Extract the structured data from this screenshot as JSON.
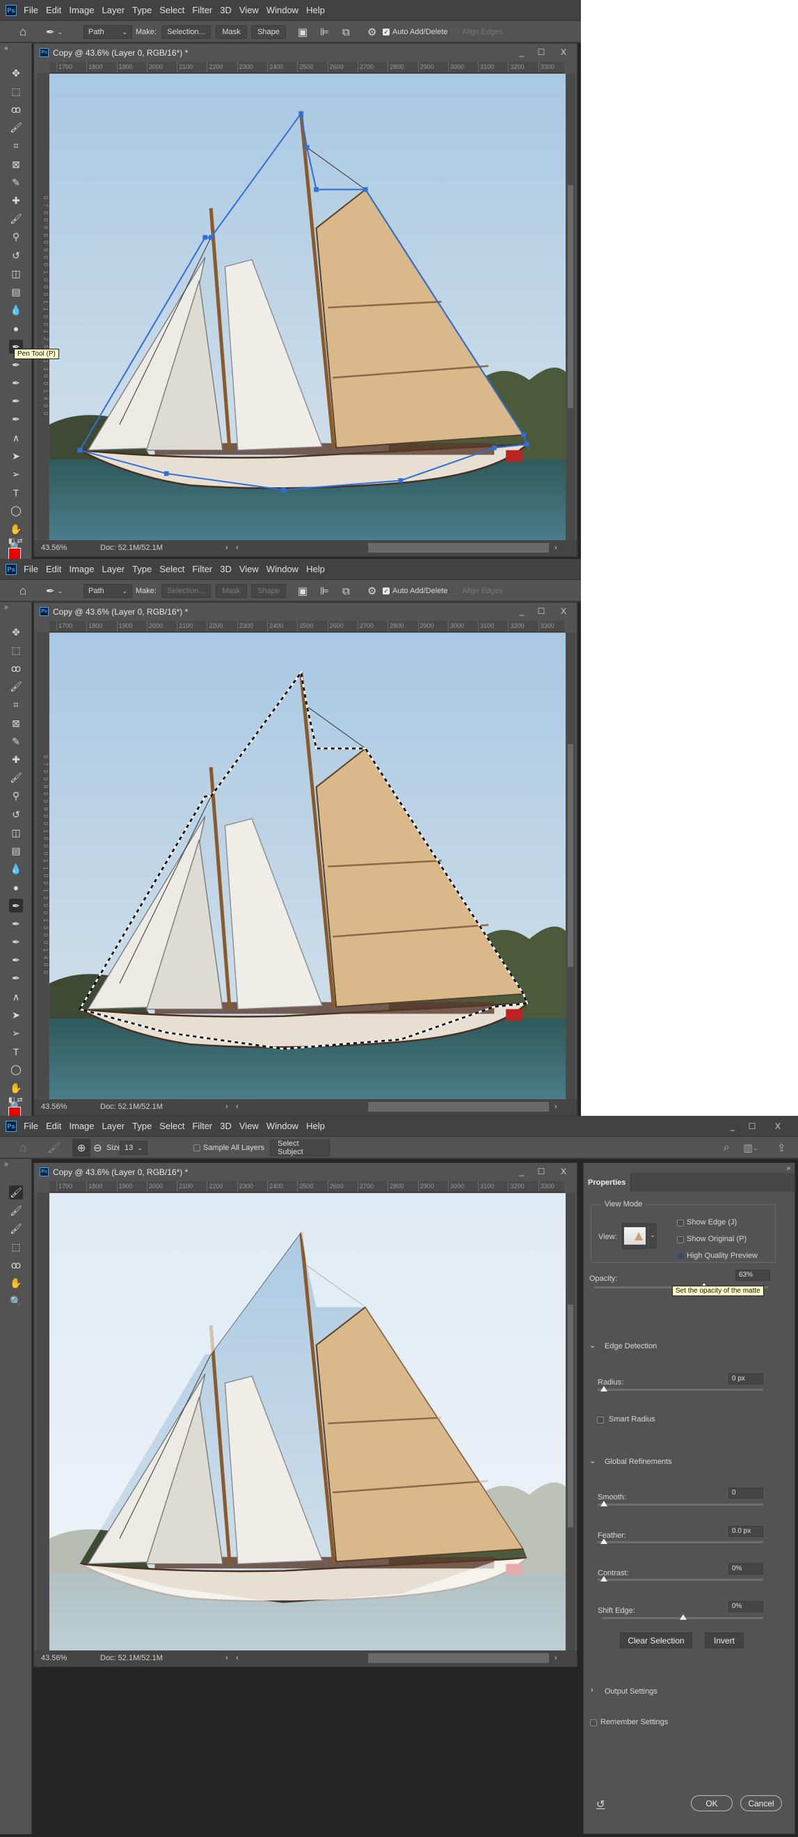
{
  "menu": [
    "File",
    "Edit",
    "Image",
    "Layer",
    "Type",
    "Select",
    "Filter",
    "3D",
    "View",
    "Window",
    "Help"
  ],
  "logo": "Ps",
  "pen_options": {
    "mode": "Path",
    "make_label": "Make:",
    "selection_btn": "Selection...",
    "mask_btn": "Mask",
    "shape_btn": "Shape",
    "auto_add_delete": "Auto Add/Delete",
    "align_edges": "Align Edges"
  },
  "document": {
    "title": "Copy @ 43.6% (Layer 0, RGB/16*) *",
    "zoom": "43.56%",
    "doc_size": "Doc: 52.1M/52.1M",
    "ruler": [
      "1700",
      "1800",
      "1900",
      "2000",
      "2100",
      "2200",
      "2300",
      "2400",
      "2500",
      "2600",
      "2700",
      "2800",
      "2900",
      "3000",
      "3100",
      "3200",
      "3300"
    ],
    "vruler": "0 7 0 0 8 0 0 9 0 0 1 0 0 0 1 1 0 0 1 2 0 0 1 3 0 0 1 4 0 0"
  },
  "tooltip_pen": "Pen Tool (P)",
  "brush_options": {
    "size_label": "Size:",
    "size_value": "13",
    "sample_all_layers": "Sample All Layers",
    "select_subject": "Select Subject"
  },
  "properties": {
    "tab": "Properties",
    "view_mode": "View Mode",
    "view_label": "View:",
    "show_edge": "Show Edge (J)",
    "show_original": "Show Original (P)",
    "high_quality": "High Quality Preview",
    "opacity_label": "Opacity:",
    "opacity_value": "63%",
    "opacity_fraction": 0.63,
    "opacity_tooltip": "Set the opacity of the matte",
    "edge_detection": "Edge Detection",
    "radius_label": "Radius:",
    "radius_value": "0 px",
    "smart_radius": "Smart Radius",
    "global_refinements": "Global Refinements",
    "smooth_label": "Smooth:",
    "smooth_value": "0",
    "feather_label": "Feather:",
    "feather_value": "0.0 px",
    "contrast_label": "Contrast:",
    "contrast_value": "0%",
    "shift_edge_label": "Shift Edge:",
    "shift_edge_value": "0%",
    "clear_selection": "Clear Selection",
    "invert": "Invert",
    "output_settings": "Output Settings",
    "remember_settings": "Remember Settings",
    "ok": "OK",
    "cancel": "Cancel"
  },
  "colors": {
    "accent": "#31a8ff",
    "path": "#2f6fd6",
    "foreground": "#e00000"
  }
}
